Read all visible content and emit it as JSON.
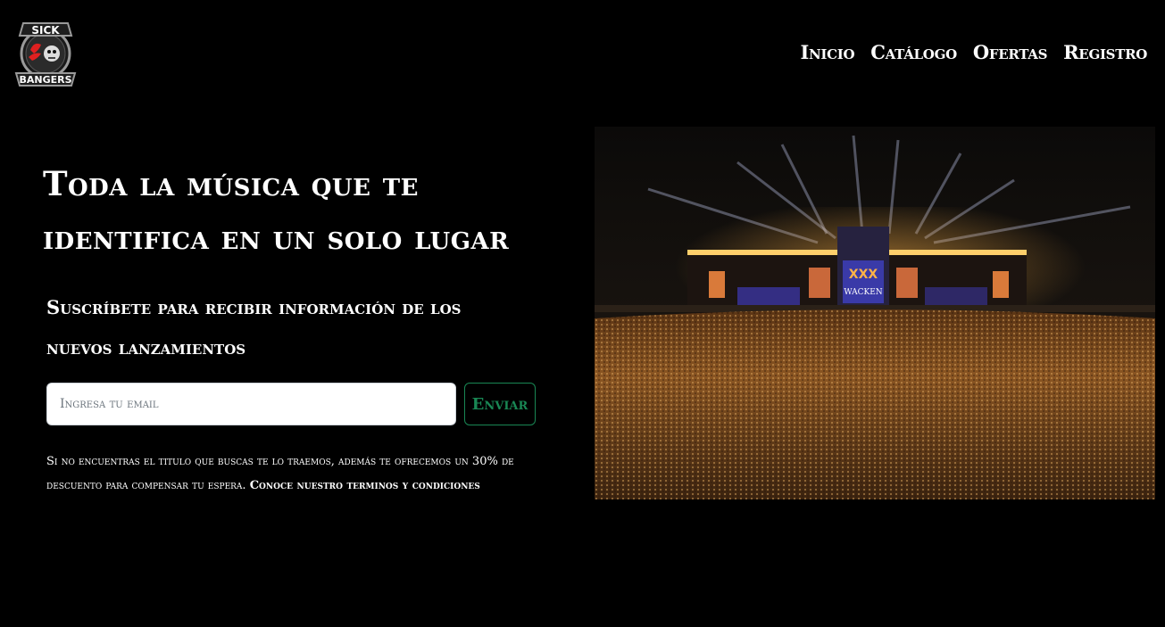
{
  "header": {
    "logo_text": [
      "SICK",
      "BANGERS"
    ],
    "nav": [
      "Inicio",
      "Catálogo",
      "Ofertas",
      "Registro"
    ]
  },
  "hero": {
    "title": "Toda la música que te identifica en un solo lugar",
    "subtitle": "Suscríbete para recibir información de los nuevos lanzamientos"
  },
  "form": {
    "email_placeholder": "Ingresa tu email",
    "send_label": "Enviar"
  },
  "note": {
    "text": "Si no encuentras el titulo que buscas te lo traemos, además te ofrecemos un 30% de descuento para compensar tu espera. ",
    "link": "Conoce nuestro terminos y condiciones"
  },
  "image": {
    "screen_text": [
      "XXX",
      "WACKEN"
    ]
  },
  "colors": {
    "background": "#000000",
    "text": "#ffffff",
    "button": "#198754"
  }
}
